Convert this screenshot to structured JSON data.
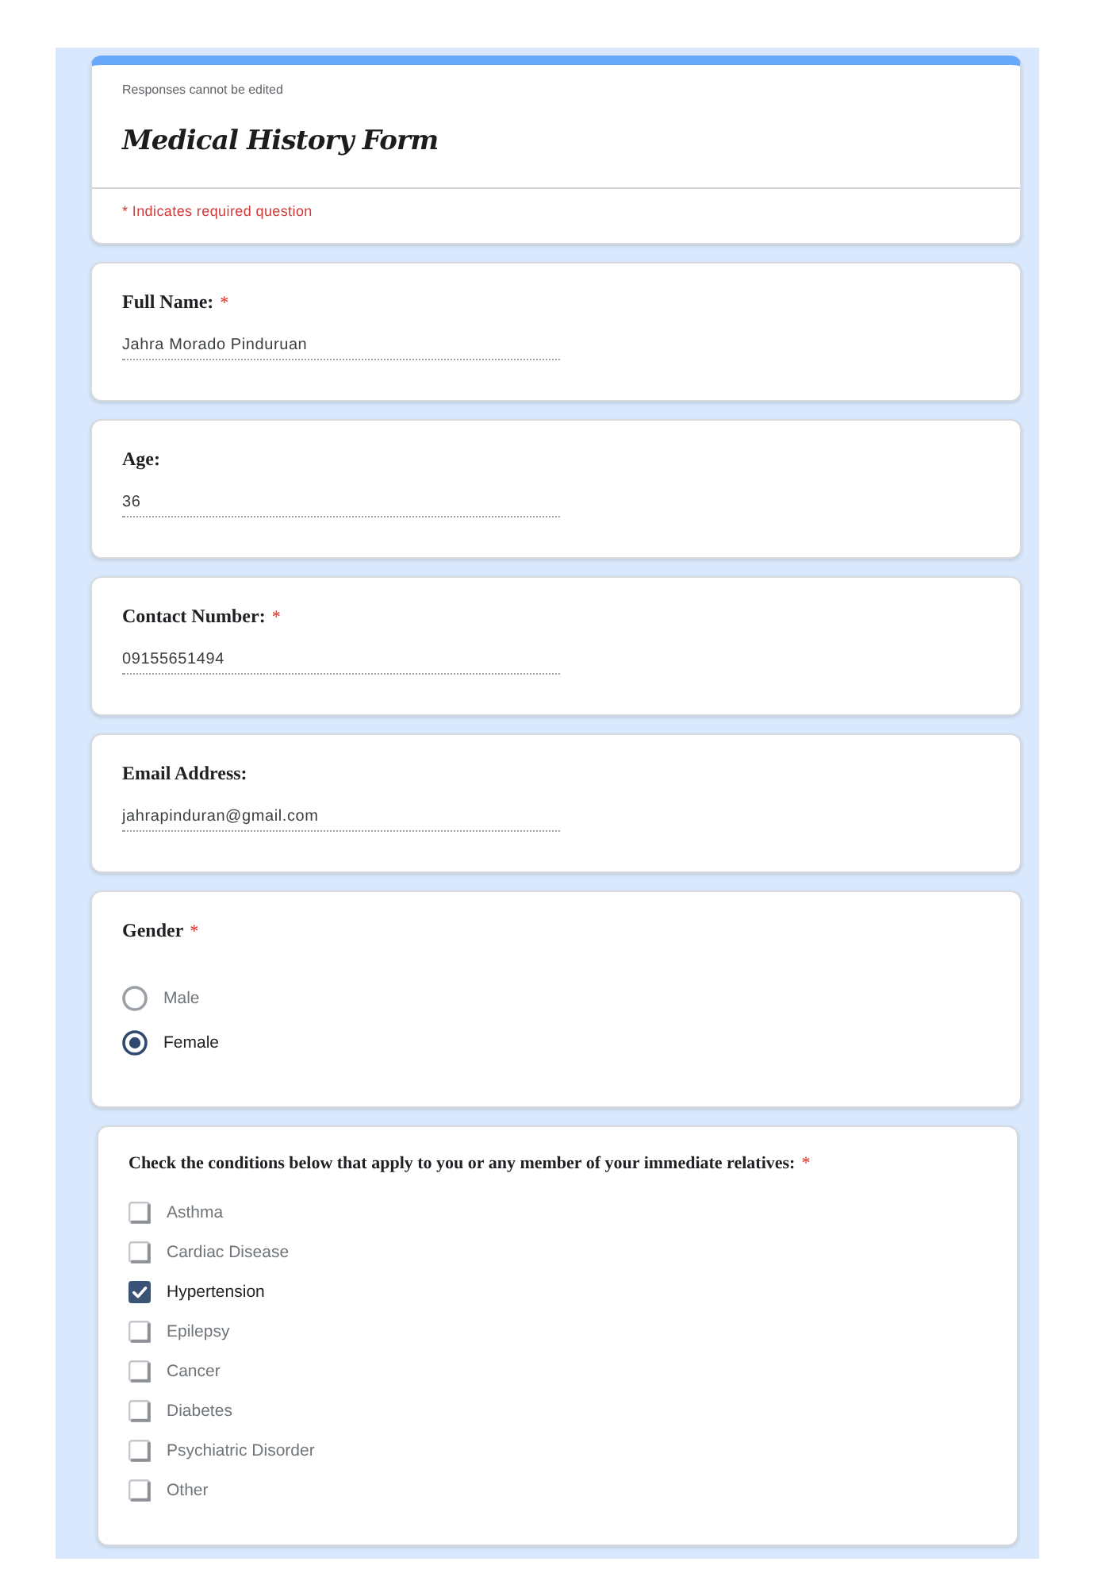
{
  "header": {
    "notice": "Responses cannot be edited",
    "title": "Medical History Form",
    "required_note": "* Indicates required question"
  },
  "questions": [
    {
      "kind": "text",
      "label": "Full Name:",
      "required_mark": "*",
      "value": "Jahra Morado Pinduruan"
    },
    {
      "kind": "text",
      "label": "Age:",
      "value": "36"
    },
    {
      "kind": "text",
      "label": "Contact Number:",
      "required_mark": "*",
      "value": "09155651494"
    },
    {
      "kind": "text",
      "label": "Email Address:",
      "value": "jahrapinduran@gmail.com"
    },
    {
      "kind": "radio",
      "label": "Gender",
      "required_mark": "*",
      "options": [
        {
          "label": "Male",
          "selected": false
        },
        {
          "label": "Female",
          "selected": true
        }
      ]
    },
    {
      "kind": "checkbox",
      "label": "Check the conditions below that apply to you or any member of your immediate relatives:",
      "required_mark": "*",
      "options": [
        {
          "label": "Asthma",
          "checked": false
        },
        {
          "label": "Cardiac Disease",
          "checked": false
        },
        {
          "label": "Hypertension",
          "checked": true
        },
        {
          "label": "Epilepsy",
          "checked": false
        },
        {
          "label": "Cancer",
          "checked": false
        },
        {
          "label": "Diabetes",
          "checked": false
        },
        {
          "label": "Psychiatric Disorder",
          "checked": false
        },
        {
          "label": "Other",
          "checked": false
        }
      ]
    }
  ]
}
